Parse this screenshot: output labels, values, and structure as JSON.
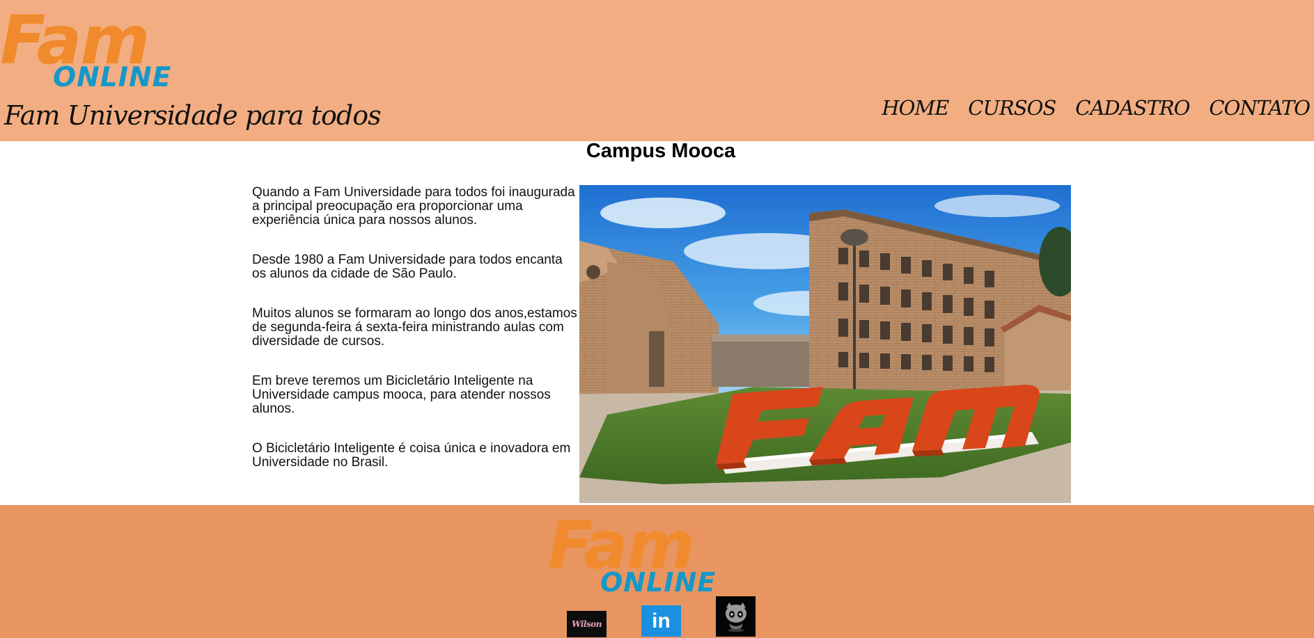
{
  "header": {
    "logo_wordmark": "Fam",
    "logo_sub": "ONLINE",
    "tagline": "Fam Universidade para todos",
    "nav": [
      {
        "label": "HOME"
      },
      {
        "label": "CURSOS"
      },
      {
        "label": "CADASTRO"
      },
      {
        "label": "CONTATO"
      }
    ]
  },
  "main": {
    "title": "Campus Mooca",
    "paragraphs": [
      "Quando a Fam Universidade para todos foi inaugurada a principal preocupação era proporcionar uma experiência única para nossos alunos.",
      "Desde 1980 a Fam Universidade para todos encanta os alunos da cidade de São Paulo.",
      "Muitos alunos se formaram ao longo dos anos,estamos de segunda-feira á sexta-feira ministrando aulas com diversidade de cursos.",
      "Em breve teremos um Bicicletário Inteligente na Universidade campus mooca, para atender nossos alunos.",
      "O Bicicletário Inteligente é coisa única e inovadora em Universidade no Brasil."
    ],
    "photo": {
      "sign_text": "Fam",
      "icon": "campus-photo"
    }
  },
  "footer": {
    "logo_wordmark": "Fam",
    "logo_sub": "ONLINE",
    "social": [
      {
        "label": "Wilson",
        "icon": "wilson-logo-icon"
      },
      {
        "label": "in",
        "icon": "linkedin-icon"
      },
      {
        "label": "",
        "icon": "github-icon"
      }
    ]
  },
  "colors": {
    "header_bg": "#f2ae82",
    "footer_bg": "#e89561",
    "brand_orange": "#f08a2c",
    "brand_blue": "#1597c8",
    "linkedin_blue": "#1b8fe0"
  }
}
